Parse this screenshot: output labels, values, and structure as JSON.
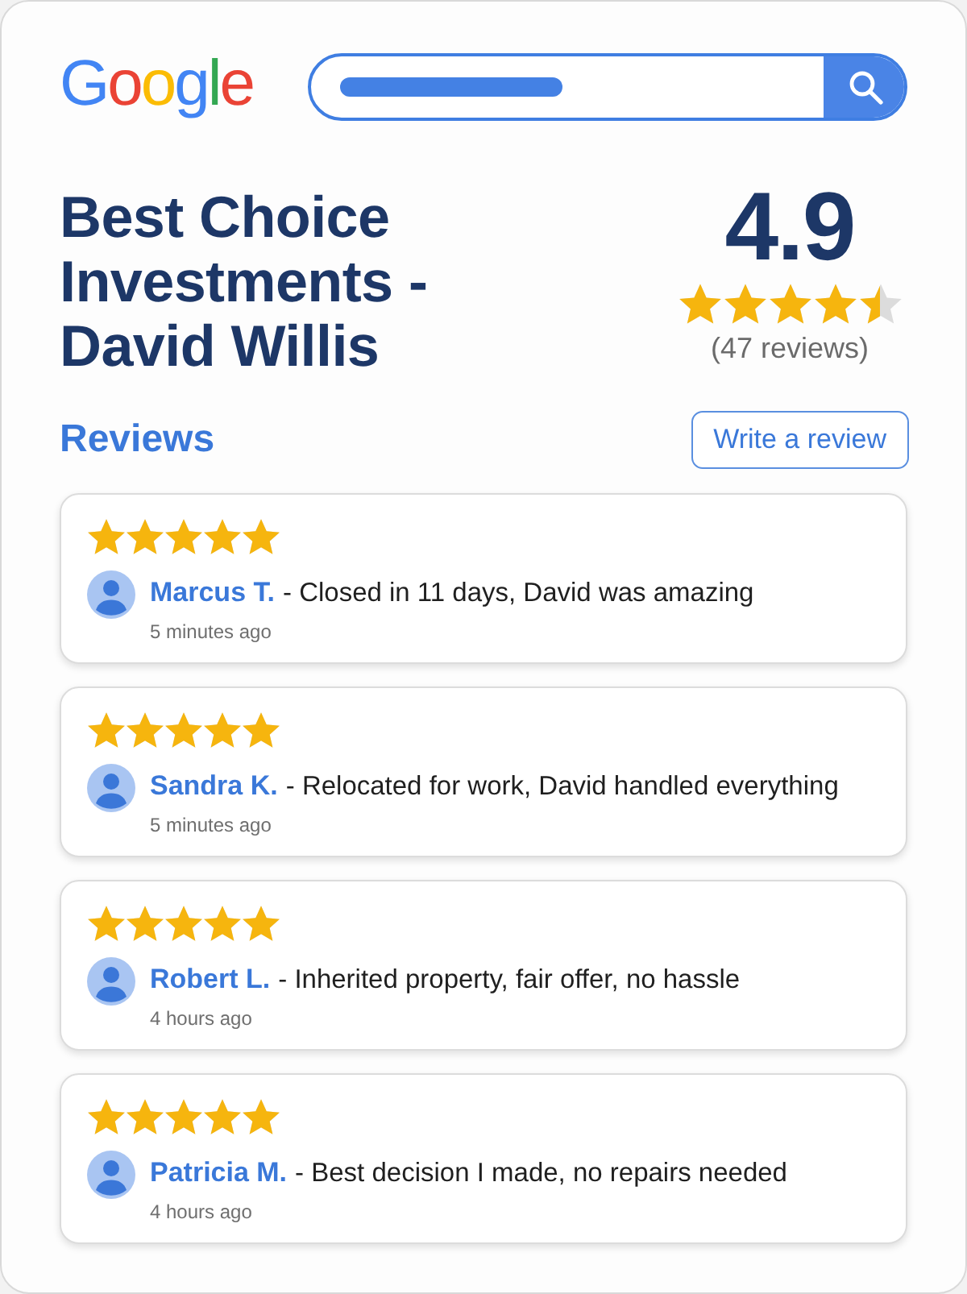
{
  "logo": "Google",
  "business": {
    "name": "Best Choice Investments - David Willis",
    "rating": "4.9",
    "stars": 4.5,
    "review_count": "(47 reviews)"
  },
  "reviews_section": {
    "title": "Reviews",
    "write_button": "Write a review"
  },
  "reviews": [
    {
      "stars": 5,
      "author": "Marcus T.",
      "text": "- Closed in 11 days, David was amazing",
      "time": "5 minutes ago"
    },
    {
      "stars": 5,
      "author": "Sandra K.",
      "text": "- Relocated for work, David handled everything",
      "time": "5 minutes ago"
    },
    {
      "stars": 5,
      "author": "Robert L.",
      "text": "- Inherited property, fair offer, no hassle",
      "time": "4 hours ago"
    },
    {
      "stars": 5,
      "author": "Patricia M.",
      "text": "- Best decision I made, no repairs needed",
      "time": "4 hours ago"
    }
  ]
}
